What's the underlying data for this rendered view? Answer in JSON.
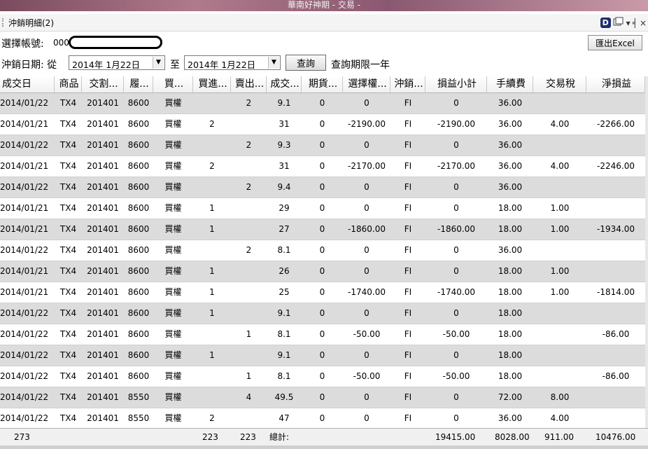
{
  "window": {
    "title": "華南好神期 - 交易 -"
  },
  "panel": {
    "title": "沖銷明細(2)",
    "d_icon": "D",
    "dropdown_glyph": "▾",
    "pin_glyph": "╡",
    "close_glyph": "×"
  },
  "account": {
    "label": "選擇帳號:",
    "value": "000"
  },
  "export_button": "匯出Excel",
  "date_filter": {
    "label": "沖銷日期: 從",
    "from": "2014年  1月22日",
    "to_label": "至",
    "to": "2014年  1月22日",
    "query_button": "查詢",
    "note": "查詢期限一年"
  },
  "table": {
    "columns": [
      "成交日",
      "商品",
      "交割...",
      "履...",
      "買...",
      "買進...",
      "賣出...",
      "成交...",
      "期貨...",
      "選擇權...",
      "沖銷...",
      "損益小計",
      "手續費",
      "交易稅",
      "淨損益"
    ],
    "rows": [
      [
        "2014/01/22",
        "TX4",
        "201401",
        "8600",
        "買權",
        "",
        "2",
        "9.1",
        "0",
        "0",
        "FI",
        "0",
        "36.00",
        "",
        ""
      ],
      [
        "2014/01/21",
        "TX4",
        "201401",
        "8600",
        "買權",
        "2",
        "",
        "31",
        "0",
        "-2190.00",
        "FI",
        "-2190.00",
        "36.00",
        "4.00",
        "-2266.00"
      ],
      [
        "2014/01/22",
        "TX4",
        "201401",
        "8600",
        "買權",
        "",
        "2",
        "9.3",
        "0",
        "0",
        "FI",
        "0",
        "36.00",
        "",
        ""
      ],
      [
        "2014/01/21",
        "TX4",
        "201401",
        "8600",
        "買權",
        "2",
        "",
        "31",
        "0",
        "-2170.00",
        "FI",
        "-2170.00",
        "36.00",
        "4.00",
        "-2246.00"
      ],
      [
        "2014/01/22",
        "TX4",
        "201401",
        "8600",
        "買權",
        "",
        "2",
        "9.4",
        "0",
        "0",
        "FI",
        "0",
        "36.00",
        "",
        ""
      ],
      [
        "2014/01/21",
        "TX4",
        "201401",
        "8600",
        "買權",
        "1",
        "",
        "29",
        "0",
        "0",
        "FI",
        "0",
        "18.00",
        "1.00",
        ""
      ],
      [
        "2014/01/21",
        "TX4",
        "201401",
        "8600",
        "買權",
        "1",
        "",
        "27",
        "0",
        "-1860.00",
        "FI",
        "-1860.00",
        "18.00",
        "1.00",
        "-1934.00"
      ],
      [
        "2014/01/22",
        "TX4",
        "201401",
        "8600",
        "買權",
        "",
        "2",
        "8.1",
        "0",
        "0",
        "FI",
        "0",
        "36.00",
        "",
        ""
      ],
      [
        "2014/01/21",
        "TX4",
        "201401",
        "8600",
        "買權",
        "1",
        "",
        "26",
        "0",
        "0",
        "FI",
        "0",
        "18.00",
        "1.00",
        ""
      ],
      [
        "2014/01/21",
        "TX4",
        "201401",
        "8600",
        "買權",
        "1",
        "",
        "25",
        "0",
        "-1740.00",
        "FI",
        "-1740.00",
        "18.00",
        "1.00",
        "-1814.00"
      ],
      [
        "2014/01/22",
        "TX4",
        "201401",
        "8600",
        "買權",
        "1",
        "",
        "9.1",
        "0",
        "0",
        "FI",
        "0",
        "18.00",
        "",
        ""
      ],
      [
        "2014/01/22",
        "TX4",
        "201401",
        "8600",
        "買權",
        "",
        "1",
        "8.1",
        "0",
        "-50.00",
        "FI",
        "-50.00",
        "18.00",
        "",
        "-86.00"
      ],
      [
        "2014/01/22",
        "TX4",
        "201401",
        "8600",
        "買權",
        "1",
        "",
        "9.1",
        "0",
        "0",
        "FI",
        "0",
        "18.00",
        "",
        ""
      ],
      [
        "2014/01/22",
        "TX4",
        "201401",
        "8600",
        "買權",
        "",
        "1",
        "8.1",
        "0",
        "-50.00",
        "FI",
        "-50.00",
        "18.00",
        "",
        "-86.00"
      ],
      [
        "2014/01/22",
        "TX4",
        "201401",
        "8550",
        "買權",
        "",
        "4",
        "49.5",
        "0",
        "0",
        "FI",
        "0",
        "72.00",
        "8.00",
        ""
      ],
      [
        "2014/01/22",
        "TX4",
        "201401",
        "8550",
        "買權",
        "2",
        "",
        "47",
        "0",
        "0",
        "FI",
        "0",
        "36.00",
        "4.00",
        ""
      ]
    ]
  },
  "totals": {
    "count": "273",
    "buy_total": "223",
    "sell_total": "223",
    "label": "總計:",
    "pl_subtotal": "19415.00",
    "fee": "8028.00",
    "tax": "911.00",
    "net": "10476.00"
  }
}
